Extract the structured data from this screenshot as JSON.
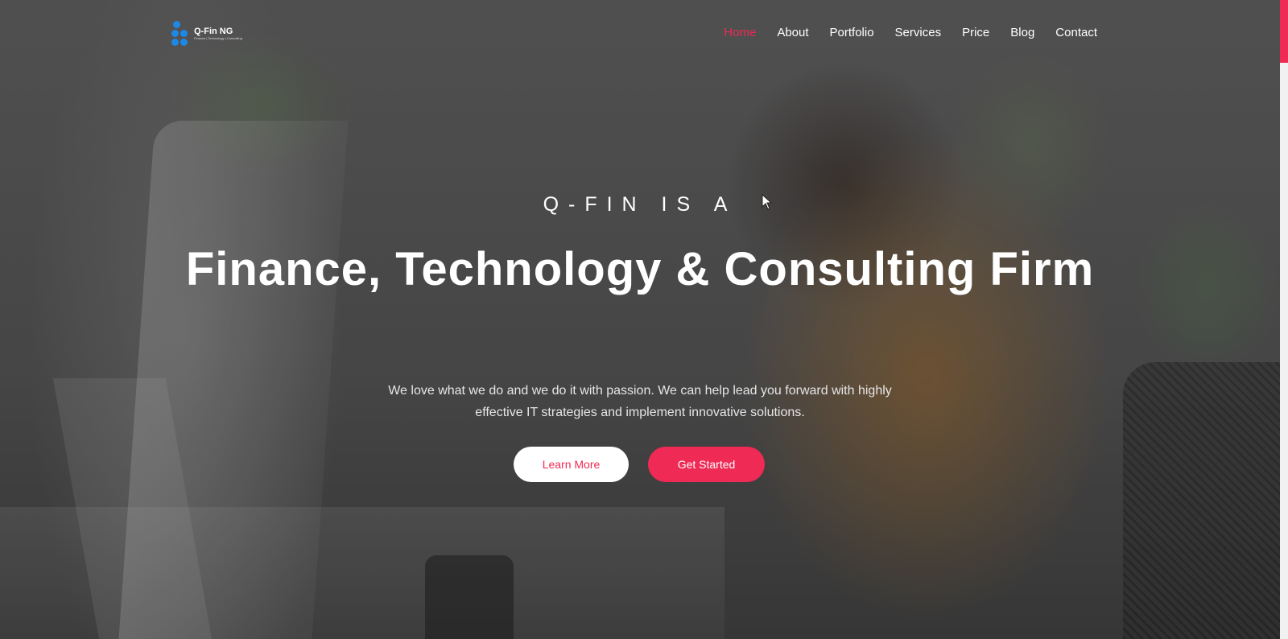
{
  "brand": {
    "name": "Q-Fin NG",
    "tagline": "Finance | Technology | Consulting",
    "logo_color": "#1e88e5"
  },
  "nav": {
    "items": [
      {
        "label": "Home",
        "active": true
      },
      {
        "label": "About",
        "active": false
      },
      {
        "label": "Portfolio",
        "active": false
      },
      {
        "label": "Services",
        "active": false
      },
      {
        "label": "Price",
        "active": false
      },
      {
        "label": "Blog",
        "active": false
      },
      {
        "label": "Contact",
        "active": false
      }
    ]
  },
  "hero": {
    "eyebrow": "Q-FIN IS A",
    "headline": "Finance, Technology & Consulting Firm",
    "subtitle": "We love what we do and we do it with passion. We can help lead you forward with highly effective IT strategies and implement innovative solutions.",
    "buttons": {
      "learn_more": "Learn More",
      "get_started": "Get Started"
    }
  },
  "colors": {
    "accent": "#ee2a55",
    "text": "#ffffff"
  }
}
